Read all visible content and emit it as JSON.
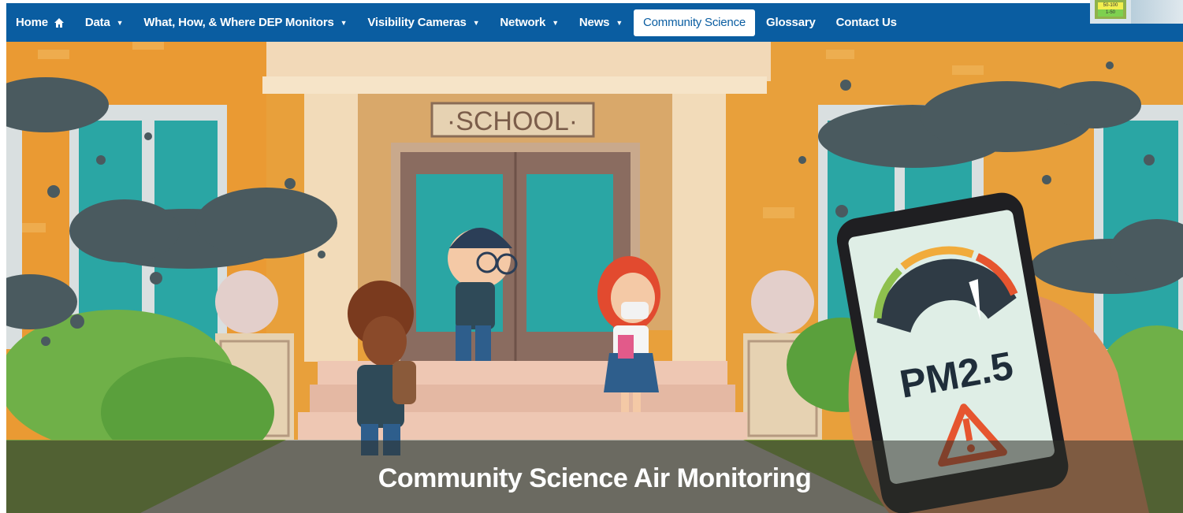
{
  "nav": {
    "items": [
      {
        "label": "Home",
        "icon": "home-icon"
      },
      {
        "label": "Data",
        "dropdown": true
      },
      {
        "label": "What, How, & Where DEP Monitors",
        "dropdown": true
      },
      {
        "label": "Visibility Cameras",
        "dropdown": true
      },
      {
        "label": "Network",
        "dropdown": true
      },
      {
        "label": "News",
        "dropdown": true
      },
      {
        "label": "Community Science",
        "active": true
      },
      {
        "label": "Glossary"
      },
      {
        "label": "Contact Us"
      }
    ]
  },
  "aqi_badge": {
    "row1": "50-100",
    "row2": "1-50"
  },
  "hero": {
    "school_sign": "·SCHOOL·",
    "phone_text": "PM2.5",
    "caption": "Community Science Air Monitoring"
  },
  "colors": {
    "nav_bg": "#0a5da1",
    "wall": "#e8a03b",
    "smoke": "#4a5a5f"
  }
}
